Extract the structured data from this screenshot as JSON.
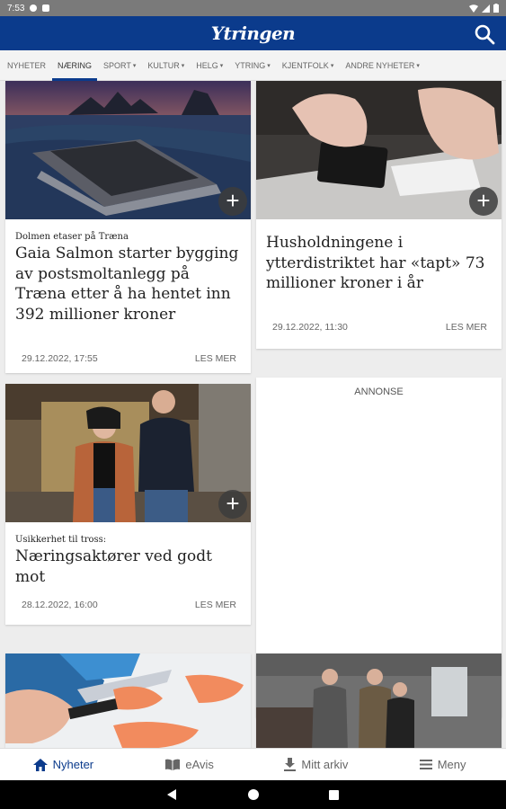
{
  "status_bar": {
    "time": "7:53"
  },
  "app": {
    "logo": "Ytringen"
  },
  "nav": {
    "items": [
      {
        "label": "NYHETER",
        "caret": false
      },
      {
        "label": "NÆRING",
        "caret": false,
        "active": true
      },
      {
        "label": "SPORT",
        "caret": true
      },
      {
        "label": "KULTUR",
        "caret": true
      },
      {
        "label": "HELG",
        "caret": true
      },
      {
        "label": "YTRING",
        "caret": true
      },
      {
        "label": "KJENTFOLK",
        "caret": true
      },
      {
        "label": "ANDRE NYHETER",
        "caret": true
      }
    ],
    "caret_glyph": "▾"
  },
  "articles": [
    {
      "kicker": "Dolmen etaser på Træna",
      "title": "Gaia Salmon starter bygging av postsmoltanlegg på Træna etter å ha hentet inn 392 millioner kroner",
      "date": "29.12.2022, 17:55",
      "more": "LES MER"
    },
    {
      "title": "Husholdningene i ytterdistriktet har «tapt» 73 millioner kroner i år",
      "date": "29.12.2022, 11:30",
      "more": "LES MER"
    },
    {
      "kicker": "Usikkerhet til tross:",
      "title": "Næringsaktører ved godt mot",
      "date": "28.12.2022, 16:00",
      "more": "LES MER"
    }
  ],
  "ad_label": "ANNONSE",
  "bottom_nav": [
    {
      "label": "Nyheter",
      "icon": "home-icon",
      "active": true
    },
    {
      "label": "eAvis",
      "icon": "book-icon"
    },
    {
      "label": "Mitt arkiv",
      "icon": "download-icon"
    },
    {
      "label": "Meny",
      "icon": "menu-icon"
    }
  ],
  "colors": {
    "brand": "#0b3b8c",
    "status_bar": "#7a7a7a"
  }
}
